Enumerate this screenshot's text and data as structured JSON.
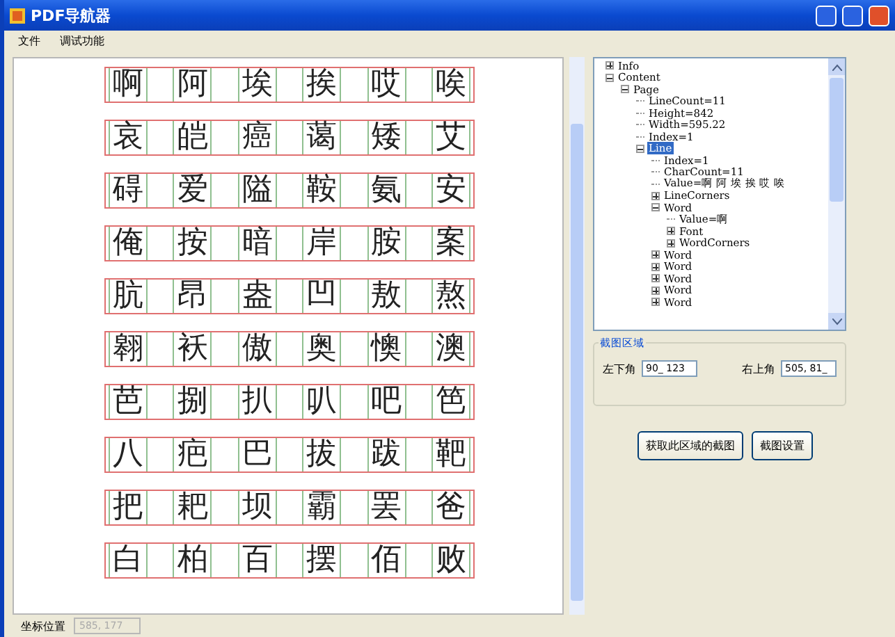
{
  "window": {
    "title": "PDF导航器"
  },
  "menu": [
    {
      "label": "文件"
    },
    {
      "label": "调试功能"
    }
  ],
  "grid_rows": [
    [
      "啊",
      "阿",
      "埃",
      "挨",
      "哎",
      "唉"
    ],
    [
      "哀",
      "皑",
      "癌",
      "蔼",
      "矮",
      "艾"
    ],
    [
      "碍",
      "爱",
      "隘",
      "鞍",
      "氨",
      "安"
    ],
    [
      "俺",
      "按",
      "暗",
      "岸",
      "胺",
      "案"
    ],
    [
      "肮",
      "昂",
      "盎",
      "凹",
      "敖",
      "熬"
    ],
    [
      "翱",
      "袄",
      "傲",
      "奥",
      "懊",
      "澳"
    ],
    [
      "芭",
      "捌",
      "扒",
      "叭",
      "吧",
      "笆"
    ],
    [
      "八",
      "疤",
      "巴",
      "拔",
      "跋",
      "靶"
    ],
    [
      "把",
      "耙",
      "坝",
      "霸",
      "罢",
      "爸"
    ],
    [
      "白",
      "柏",
      "百",
      "摆",
      "佰",
      "败"
    ]
  ],
  "tree": [
    {
      "label": "Info",
      "expanded": false,
      "selected": false
    },
    {
      "label": "Content",
      "expanded": true,
      "selected": false,
      "children": [
        {
          "label": "Page",
          "expanded": true,
          "selected": false,
          "children": [
            {
              "label": "LineCount=11",
              "selected": false
            },
            {
              "label": "Height=842",
              "selected": false
            },
            {
              "label": "Width=595.22",
              "selected": false
            },
            {
              "label": "Index=1",
              "selected": false
            },
            {
              "label": "Line",
              "expanded": true,
              "selected": true,
              "children": [
                {
                  "label": "Index=1",
                  "selected": false
                },
                {
                  "label": "CharCount=11",
                  "selected": false
                },
                {
                  "label": "Value=啊 阿 埃 挨 哎 唉",
                  "selected": false
                },
                {
                  "label": "LineCorners",
                  "expanded": false,
                  "selected": false
                },
                {
                  "label": "Word",
                  "expanded": true,
                  "selected": false,
                  "children": [
                    {
                      "label": "Value=啊",
                      "selected": false
                    },
                    {
                      "label": "Font",
                      "expanded": false,
                      "selected": false
                    },
                    {
                      "label": "WordCorners",
                      "expanded": false,
                      "selected": false
                    }
                  ]
                },
                {
                  "label": "Word",
                  "expanded": false,
                  "selected": false
                },
                {
                  "label": "Word",
                  "expanded": false,
                  "selected": false
                },
                {
                  "label": "Word",
                  "expanded": false,
                  "selected": false
                },
                {
                  "label": "Word",
                  "expanded": false,
                  "selected": false
                },
                {
                  "label": "Word",
                  "expanded": false,
                  "selected": false
                }
              ]
            }
          ]
        }
      ]
    }
  ],
  "capture_area": {
    "title": "截图区域",
    "lower_left_label": "左下角",
    "lower_left_value": "90_ 123",
    "upper_right_label": "右上角",
    "upper_right_value": "505, 81_"
  },
  "buttons": [
    {
      "label": "获取此区域的截图"
    },
    {
      "label": "截图设置"
    }
  ],
  "status_bar": {
    "label": "坐标位置",
    "value": "585, 177"
  }
}
